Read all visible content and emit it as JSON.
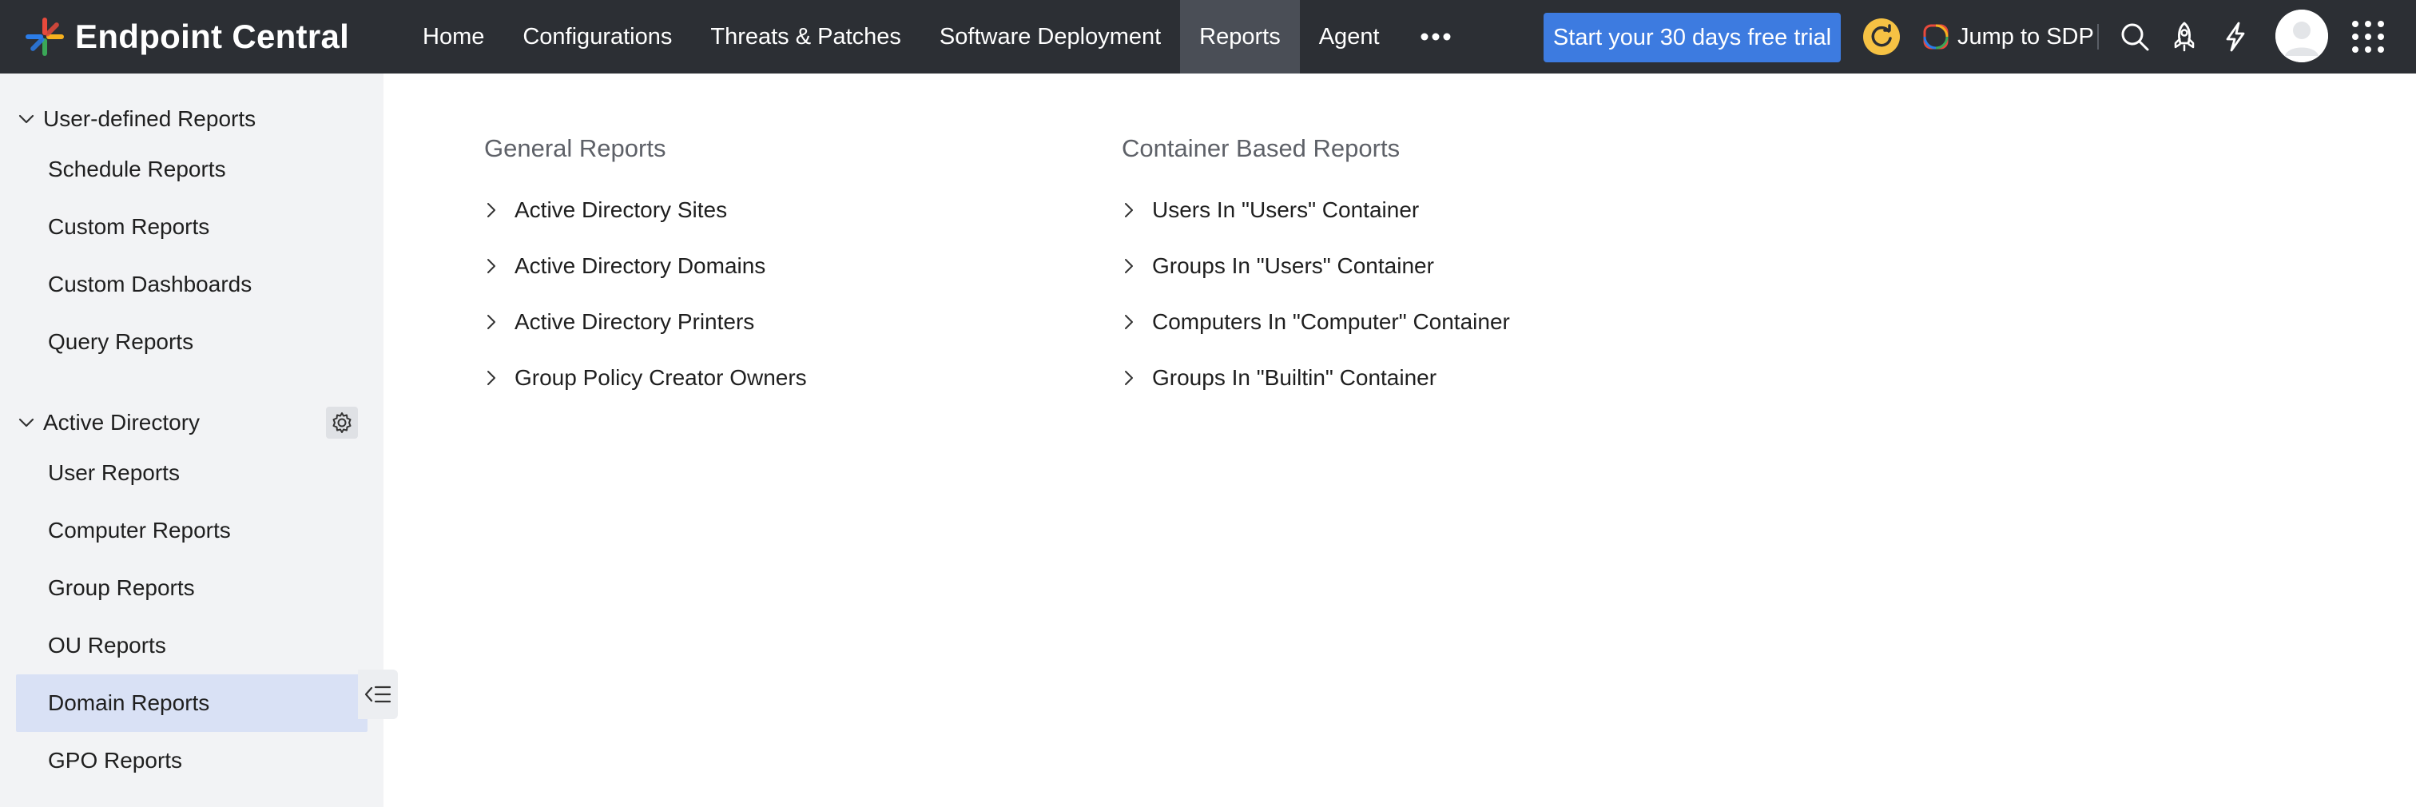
{
  "header": {
    "app_name": "Endpoint Central",
    "nav": [
      {
        "label": "Home"
      },
      {
        "label": "Configurations"
      },
      {
        "label": "Threats & Patches"
      },
      {
        "label": "Software Deployment"
      },
      {
        "label": "Reports",
        "active": true
      },
      {
        "label": "Agent"
      }
    ],
    "more_icon": "more-horizontal-icon",
    "trial_button": "Start your 30 days free trial",
    "jump_sdp": "Jump to SDP",
    "icons": [
      "refresh-badge-icon",
      "search-icon",
      "rocket-icon",
      "lightning-icon",
      "avatar",
      "app-grid-icon"
    ]
  },
  "sidebar": {
    "sections": [
      {
        "title": "User-defined Reports",
        "expanded": true,
        "items": [
          "Schedule Reports",
          "Custom Reports",
          "Custom Dashboards",
          "Query Reports"
        ]
      },
      {
        "title": "Active Directory",
        "expanded": true,
        "has_settings": true,
        "items": [
          "User Reports",
          "Computer Reports",
          "Group Reports",
          "OU Reports",
          "Domain Reports",
          "GPO Reports"
        ],
        "selected": "Domain Reports"
      }
    ]
  },
  "main": {
    "columns": [
      {
        "title": "General Reports",
        "links": [
          "Active Directory Sites",
          "Active Directory Domains",
          "Active Directory Printers",
          "Group Policy Creator Owners"
        ]
      },
      {
        "title": "Container Based Reports",
        "links": [
          "Users In \"Users\" Container",
          "Groups In \"Users\" Container",
          "Computers In \"Computer\" Container",
          "Groups In \"Builtin\" Container"
        ]
      }
    ]
  },
  "colors": {
    "topbar": "#2c2f34",
    "nav_active": "#4a4e56",
    "trial_button": "#3d7be0",
    "sidebar_bg": "#f2f3f5",
    "sidebar_selected": "#d9e1f5",
    "refresh_badge": "#f6c244"
  }
}
